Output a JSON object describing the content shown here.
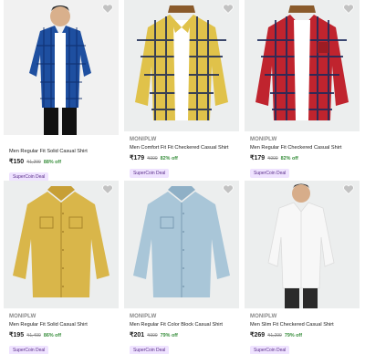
{
  "products": [
    {
      "brand": "",
      "title": "Men Regular Fit Solid Casual Shirt",
      "price": "₹150",
      "mrp": "₹1,299",
      "discount": "88% off",
      "deal": "SuperCoin Deal",
      "colors": {
        "bg": "#f1f1f1",
        "shirt": "#1e4fa0",
        "check": "#0d2a66",
        "accent": "#0b1a3b"
      }
    },
    {
      "brand": "MONIPLW",
      "title": "Men Comfort Fit Fit Checkered Casual Shirt",
      "price": "₹179",
      "mrp": "₹999",
      "discount": "82% off",
      "deal": "SuperCoin Deal",
      "colors": {
        "bg": "#eceeee",
        "shirt": "#e0c24a",
        "check": "#1d2a55",
        "accent": "#2b2b2b"
      }
    },
    {
      "brand": "MONIPLW",
      "title": "Men Regular Fit Checkered Casual Shirt",
      "price": "₹179",
      "mrp": "₹999",
      "discount": "82% off",
      "deal": "SuperCoin Deal",
      "colors": {
        "bg": "#eceeee",
        "shirt": "#c0242e",
        "check": "#1b2a5c",
        "accent": "#6a1016"
      }
    },
    {
      "brand": "MONIPLW",
      "title": "Men Regular Fit Solid Casual Shirt",
      "price": "₹195",
      "mrp": "₹1,499",
      "discount": "86% off",
      "deal": "SuperCoin Deal",
      "colors": {
        "bg": "#eceeee",
        "shirt": "#d9b64a",
        "check": "#c79f36",
        "accent": "#a9852b"
      }
    },
    {
      "brand": "MONIPLW",
      "title": "Men Regular Fit Color Block Casual Shirt",
      "price": "₹201",
      "mrp": "₹999",
      "discount": "79% off",
      "deal": "SuperCoin Deal",
      "colors": {
        "bg": "#eceeee",
        "shirt": "#a9c6d8",
        "check": "#8fb0c6",
        "accent": "#7b9cb3"
      }
    },
    {
      "brand": "MONIPLW",
      "title": "Men Slim Fit Checkered Casual Shirt",
      "price": "₹269",
      "mrp": "₹1,299",
      "discount": "79% off",
      "deal": "SuperCoin Deal",
      "colors": {
        "bg": "#eceeee",
        "shirt": "#f7f7f7",
        "check": "#e3e3e3",
        "accent": "#2a2a2a"
      }
    }
  ],
  "icons": {
    "wishlist": "heart-icon"
  }
}
